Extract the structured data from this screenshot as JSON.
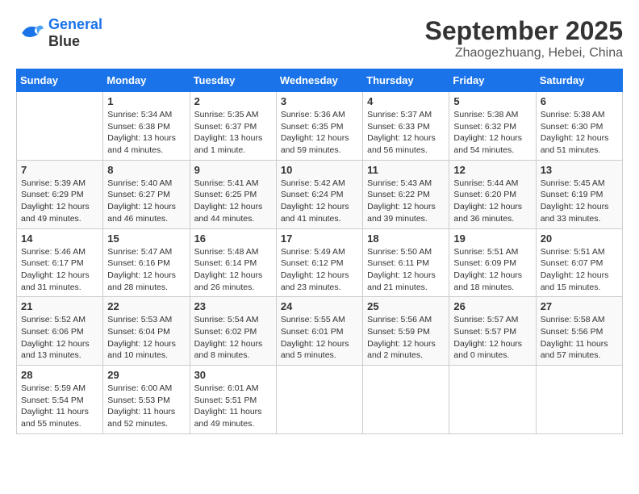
{
  "header": {
    "logo_line1": "General",
    "logo_line2": "Blue",
    "title": "September 2025",
    "subtitle": "Zhaogezhuang, Hebei, China"
  },
  "days_of_week": [
    "Sunday",
    "Monday",
    "Tuesday",
    "Wednesday",
    "Thursday",
    "Friday",
    "Saturday"
  ],
  "weeks": [
    [
      null,
      {
        "day": 1,
        "sunrise": "Sunrise: 5:34 AM",
        "sunset": "Sunset: 6:38 PM",
        "daylight": "Daylight: 13 hours and 4 minutes."
      },
      {
        "day": 2,
        "sunrise": "Sunrise: 5:35 AM",
        "sunset": "Sunset: 6:37 PM",
        "daylight": "Daylight: 13 hours and 1 minute."
      },
      {
        "day": 3,
        "sunrise": "Sunrise: 5:36 AM",
        "sunset": "Sunset: 6:35 PM",
        "daylight": "Daylight: 12 hours and 59 minutes."
      },
      {
        "day": 4,
        "sunrise": "Sunrise: 5:37 AM",
        "sunset": "Sunset: 6:33 PM",
        "daylight": "Daylight: 12 hours and 56 minutes."
      },
      {
        "day": 5,
        "sunrise": "Sunrise: 5:38 AM",
        "sunset": "Sunset: 6:32 PM",
        "daylight": "Daylight: 12 hours and 54 minutes."
      },
      {
        "day": 6,
        "sunrise": "Sunrise: 5:38 AM",
        "sunset": "Sunset: 6:30 PM",
        "daylight": "Daylight: 12 hours and 51 minutes."
      }
    ],
    [
      {
        "day": 7,
        "sunrise": "Sunrise: 5:39 AM",
        "sunset": "Sunset: 6:29 PM",
        "daylight": "Daylight: 12 hours and 49 minutes."
      },
      {
        "day": 8,
        "sunrise": "Sunrise: 5:40 AM",
        "sunset": "Sunset: 6:27 PM",
        "daylight": "Daylight: 12 hours and 46 minutes."
      },
      {
        "day": 9,
        "sunrise": "Sunrise: 5:41 AM",
        "sunset": "Sunset: 6:25 PM",
        "daylight": "Daylight: 12 hours and 44 minutes."
      },
      {
        "day": 10,
        "sunrise": "Sunrise: 5:42 AM",
        "sunset": "Sunset: 6:24 PM",
        "daylight": "Daylight: 12 hours and 41 minutes."
      },
      {
        "day": 11,
        "sunrise": "Sunrise: 5:43 AM",
        "sunset": "Sunset: 6:22 PM",
        "daylight": "Daylight: 12 hours and 39 minutes."
      },
      {
        "day": 12,
        "sunrise": "Sunrise: 5:44 AM",
        "sunset": "Sunset: 6:20 PM",
        "daylight": "Daylight: 12 hours and 36 minutes."
      },
      {
        "day": 13,
        "sunrise": "Sunrise: 5:45 AM",
        "sunset": "Sunset: 6:19 PM",
        "daylight": "Daylight: 12 hours and 33 minutes."
      }
    ],
    [
      {
        "day": 14,
        "sunrise": "Sunrise: 5:46 AM",
        "sunset": "Sunset: 6:17 PM",
        "daylight": "Daylight: 12 hours and 31 minutes."
      },
      {
        "day": 15,
        "sunrise": "Sunrise: 5:47 AM",
        "sunset": "Sunset: 6:16 PM",
        "daylight": "Daylight: 12 hours and 28 minutes."
      },
      {
        "day": 16,
        "sunrise": "Sunrise: 5:48 AM",
        "sunset": "Sunset: 6:14 PM",
        "daylight": "Daylight: 12 hours and 26 minutes."
      },
      {
        "day": 17,
        "sunrise": "Sunrise: 5:49 AM",
        "sunset": "Sunset: 6:12 PM",
        "daylight": "Daylight: 12 hours and 23 minutes."
      },
      {
        "day": 18,
        "sunrise": "Sunrise: 5:50 AM",
        "sunset": "Sunset: 6:11 PM",
        "daylight": "Daylight: 12 hours and 21 minutes."
      },
      {
        "day": 19,
        "sunrise": "Sunrise: 5:51 AM",
        "sunset": "Sunset: 6:09 PM",
        "daylight": "Daylight: 12 hours and 18 minutes."
      },
      {
        "day": 20,
        "sunrise": "Sunrise: 5:51 AM",
        "sunset": "Sunset: 6:07 PM",
        "daylight": "Daylight: 12 hours and 15 minutes."
      }
    ],
    [
      {
        "day": 21,
        "sunrise": "Sunrise: 5:52 AM",
        "sunset": "Sunset: 6:06 PM",
        "daylight": "Daylight: 12 hours and 13 minutes."
      },
      {
        "day": 22,
        "sunrise": "Sunrise: 5:53 AM",
        "sunset": "Sunset: 6:04 PM",
        "daylight": "Daylight: 12 hours and 10 minutes."
      },
      {
        "day": 23,
        "sunrise": "Sunrise: 5:54 AM",
        "sunset": "Sunset: 6:02 PM",
        "daylight": "Daylight: 12 hours and 8 minutes."
      },
      {
        "day": 24,
        "sunrise": "Sunrise: 5:55 AM",
        "sunset": "Sunset: 6:01 PM",
        "daylight": "Daylight: 12 hours and 5 minutes."
      },
      {
        "day": 25,
        "sunrise": "Sunrise: 5:56 AM",
        "sunset": "Sunset: 5:59 PM",
        "daylight": "Daylight: 12 hours and 2 minutes."
      },
      {
        "day": 26,
        "sunrise": "Sunrise: 5:57 AM",
        "sunset": "Sunset: 5:57 PM",
        "daylight": "Daylight: 12 hours and 0 minutes."
      },
      {
        "day": 27,
        "sunrise": "Sunrise: 5:58 AM",
        "sunset": "Sunset: 5:56 PM",
        "daylight": "Daylight: 11 hours and 57 minutes."
      }
    ],
    [
      {
        "day": 28,
        "sunrise": "Sunrise: 5:59 AM",
        "sunset": "Sunset: 5:54 PM",
        "daylight": "Daylight: 11 hours and 55 minutes."
      },
      {
        "day": 29,
        "sunrise": "Sunrise: 6:00 AM",
        "sunset": "Sunset: 5:53 PM",
        "daylight": "Daylight: 11 hours and 52 minutes."
      },
      {
        "day": 30,
        "sunrise": "Sunrise: 6:01 AM",
        "sunset": "Sunset: 5:51 PM",
        "daylight": "Daylight: 11 hours and 49 minutes."
      },
      null,
      null,
      null,
      null
    ]
  ]
}
